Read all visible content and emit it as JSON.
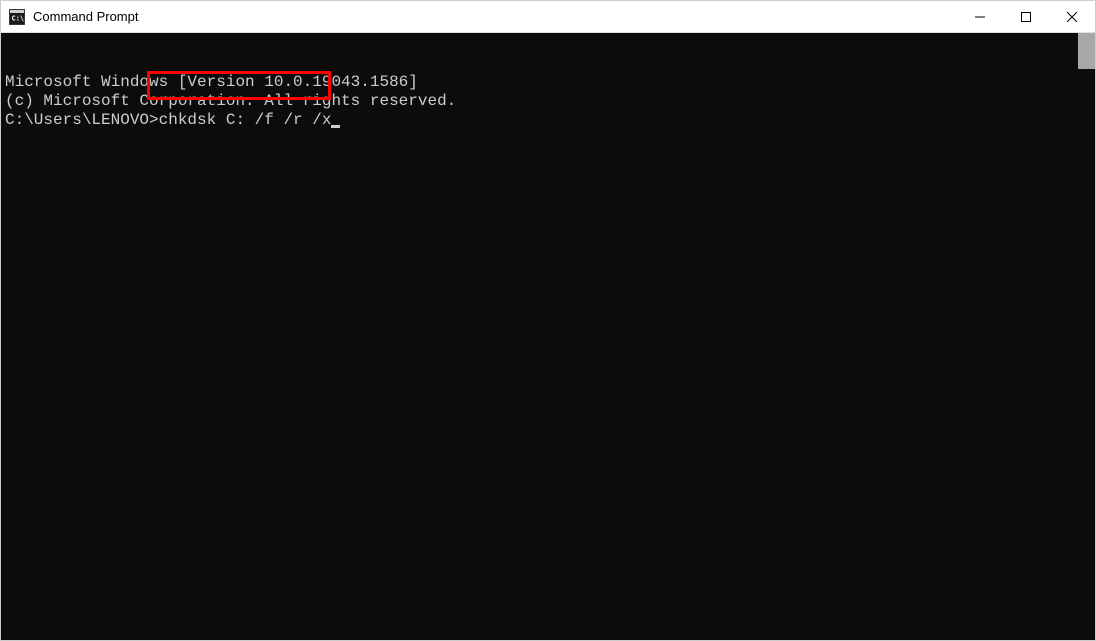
{
  "window": {
    "title": "Command Prompt"
  },
  "terminal": {
    "line1": "Microsoft Windows [Version 10.0.19043.1586]",
    "line2": "(c) Microsoft Corporation. All rights reserved.",
    "blank": "",
    "prompt": "C:\\Users\\LENOVO>",
    "command": "chkdsk C: /f /r /x"
  }
}
